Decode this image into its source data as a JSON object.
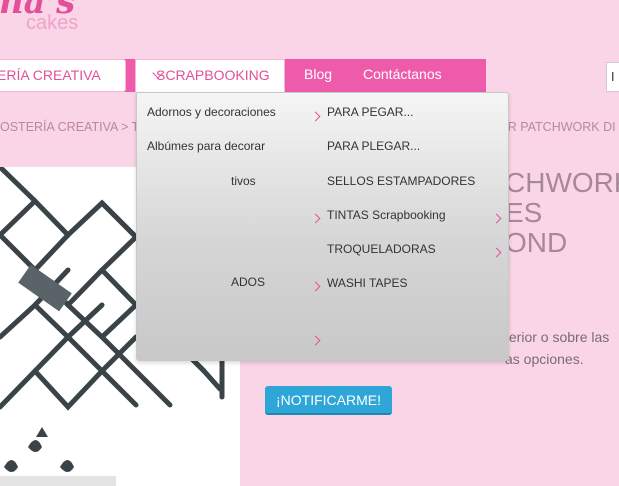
{
  "logo": {
    "main": "ina's",
    "sub": "cakes"
  },
  "nav": {
    "items": [
      {
        "label": "ERÍA CREATIVA"
      },
      {
        "label": "SCRAPBOOKING"
      },
      {
        "label": "Blog"
      },
      {
        "label": "Contáctanos"
      }
    ],
    "cart_text": "I"
  },
  "breadcrumb": {
    "left": "OSTERÍA CREATIVA  >  TO",
    "right": "OR PATCHWORK DI"
  },
  "dropdown": {
    "col1": [
      {
        "label": "Adornos y decoraciones"
      },
      {
        "label": "Albúmes para decorar"
      },
      {
        "label": "tivos"
      },
      {
        "label": ""
      },
      {
        "label": ""
      },
      {
        "label": "ADOS"
      },
      {
        "label": ""
      }
    ],
    "col2": [
      {
        "label": "PARA PEGAR..."
      },
      {
        "label": "PARA PLEGAR..."
      },
      {
        "label": "SELLOS ESTAMPADORES"
      },
      {
        "label": "TINTAS Scrapbooking"
      },
      {
        "label": "TROQUELADORAS"
      },
      {
        "label": "WASHI TAPES"
      }
    ]
  },
  "product": {
    "title_lines": [
      "CHWORK",
      "ES",
      "OND"
    ],
    "desc_lines": [
      "ferior o sobre las",
      "as opciones."
    ],
    "notify_label": "¡NOTIFICARME!"
  },
  "colors": {
    "accent": "#ef5bab",
    "background": "#f9d5e7",
    "button": "#2ea6d8"
  }
}
